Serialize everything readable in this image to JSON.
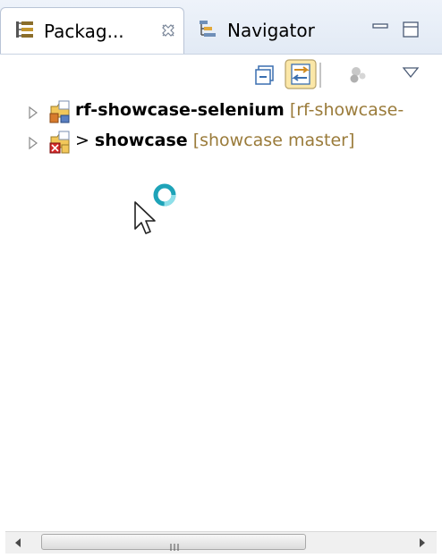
{
  "tabs": [
    {
      "label": "Packag...",
      "icon": "package-explorer-icon",
      "active": true
    },
    {
      "label": "Navigator",
      "icon": "navigator-icon",
      "active": false
    }
  ],
  "window_controls": [
    "minimize-icon",
    "maximize-icon"
  ],
  "toolbar": [
    "collapse-all-icon",
    "link-with-editor-icon",
    "filter-icon",
    "view-menu-icon"
  ],
  "tree": {
    "items": [
      {
        "name": "rf-showcase-selenium",
        "dirty_prefix": "",
        "decoration": "[rf-showcase-"
      },
      {
        "name": "showcase",
        "dirty_prefix": ">",
        "decoration": "[showcase master]"
      }
    ]
  },
  "colors": {
    "tab_active_bg": "#ffffff",
    "tab_bar_bg": "#e2eaf5",
    "decoration_text": "#9a7b3a",
    "link_button_highlight": "#fbe7a8"
  }
}
